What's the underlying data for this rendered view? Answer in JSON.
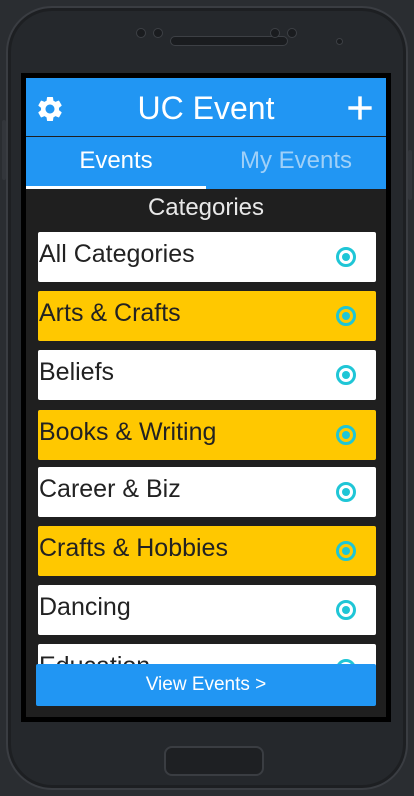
{
  "app": {
    "title": "UC Event",
    "settings_icon": "gear-icon",
    "add_icon": "plus-icon"
  },
  "tabs": [
    {
      "label": "Events",
      "active": true
    },
    {
      "label": "My Events",
      "active": false
    }
  ],
  "section_title": "Categories",
  "categories": [
    {
      "label": "All Categories",
      "selected": true
    },
    {
      "label": "Arts & Crafts",
      "selected": true
    },
    {
      "label": "Beliefs",
      "selected": true
    },
    {
      "label": "Books & Writing",
      "selected": true
    },
    {
      "label": "Career & Biz",
      "selected": true
    },
    {
      "label": "Crafts & Hobbies",
      "selected": true
    },
    {
      "label": "Dancing",
      "selected": true
    },
    {
      "label": "Education",
      "selected": true
    }
  ],
  "footer": {
    "view_button": "View Events >"
  },
  "colors": {
    "primary": "#2196f3",
    "highlight_row": "#ffc800",
    "radio": "#1fc6d6",
    "background": "#1f1f1f"
  }
}
